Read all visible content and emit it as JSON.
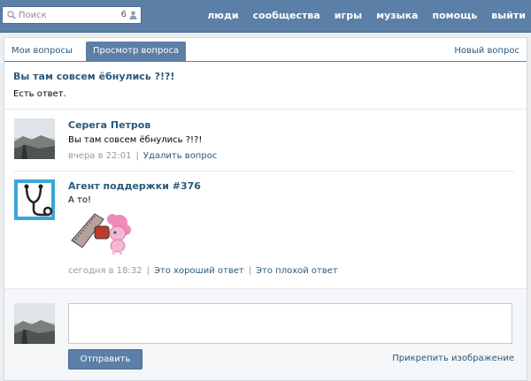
{
  "header": {
    "search_placeholder": "Поиск",
    "search_count": "6",
    "nav": [
      "люди",
      "сообщества",
      "игры",
      "музыка",
      "помощь",
      "выйти"
    ]
  },
  "tabs": {
    "my_questions": "Мои вопросы",
    "view_question": "Просмотр вопроса",
    "new_question": "Новый вопрос"
  },
  "question": {
    "title": "Вы там совсем ёбнулись ?!?!",
    "status": "Есть ответ."
  },
  "messages": [
    {
      "author": "Серега Петров",
      "text": "Вы там совсем ёбнулись ?!?!",
      "time": "вчера в 22:01",
      "actions": [
        "Удалить вопрос"
      ]
    },
    {
      "author": "Агент поддержки #376",
      "text": "А то!",
      "time": "сегодня в 18:32",
      "actions": [
        "Это хороший ответ",
        "Это плохой ответ"
      ]
    }
  ],
  "reply": {
    "send_label": "Отправить",
    "attach_label": "Прикрепить изображение"
  },
  "colors": {
    "header_bg": "#5b7fa6",
    "link": "#2b587a",
    "meta": "#999999"
  }
}
